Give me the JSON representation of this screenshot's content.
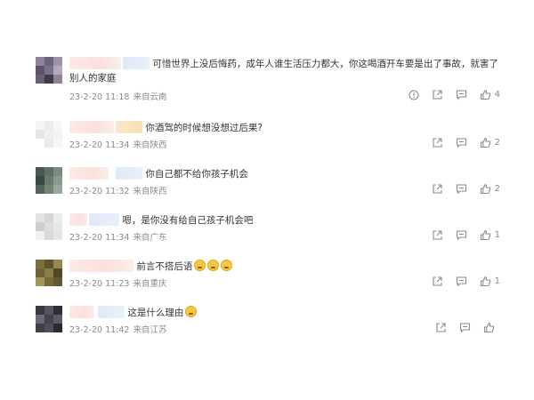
{
  "comments": [
    {
      "text": "可惜世界上没后悔药，成年人谁生活压力都大，你这喝酒开车要是出了事故，就害了别人的家庭",
      "time": "23-2-20 11:18",
      "location": "来自云南",
      "likes": "4",
      "has_report_icon": true,
      "avatar_colors": [
        "#8f8399",
        "#6d6479",
        "#9e93a8",
        "#5c5468",
        "#7c7187",
        "#b3a9bb",
        "#6a6075",
        "#3f394a",
        "#8e8398"
      ]
    },
    {
      "text": "你酒驾的时候想没想过后果?",
      "time": "23-2-20 11:34",
      "location": "来自陕西",
      "likes": "2",
      "avatar_colors": [
        "#f4f4f4",
        "#ececec",
        "#f7f7f7",
        "#e6e6e6",
        "#efefef",
        "#f2f2f2",
        "#ffffff",
        "#eaeaea",
        "#f6f6f6"
      ]
    },
    {
      "text": "你自己都不给你孩子机会",
      "time": "23-2-20 11:32",
      "location": "来自陕西",
      "likes": "2",
      "avatar_colors": [
        "#47594e",
        "#5f7062",
        "#7c8b7f",
        "#3b4a41",
        "#687a6c",
        "#8b9a8e",
        "#53645a",
        "#76857a",
        "#9aa89c"
      ]
    },
    {
      "text": "嗯，是你没有给自己孩子机会吧",
      "time": "23-2-20 11:34",
      "location": "来自广东",
      "likes": "1",
      "avatar_colors": [
        "#e3e3e3",
        "#d6d6d6",
        "#ececec",
        "#cfcfcf",
        "#dddddd",
        "#e8e8e8",
        "#f0f0f0",
        "#d9d9d9",
        "#e5e5e5"
      ]
    },
    {
      "text": "前言不搭后语",
      "time": "23-2-20 11:23",
      "location": "来自重庆",
      "likes": "1",
      "emoji_count": 3,
      "avatar_colors": [
        "#7a6e3d",
        "#5f5330",
        "#96894f",
        "#6e6236",
        "#8a7d45",
        "#534825",
        "#a39659",
        "#786b3a",
        "#645830"
      ]
    },
    {
      "text": "这是什么理由",
      "time": "23-2-20 11:42",
      "location": "来自江苏",
      "likes": "",
      "emoji_count": 1,
      "avatar_colors": [
        "#3a3a44",
        "#55555f",
        "#2e2e36",
        "#6a6a72",
        "#44444d",
        "#5c5c64",
        "#3f3f48",
        "#4f4f58",
        "#2a2a31"
      ]
    }
  ],
  "icons": {
    "report": "report-icon",
    "share": "share-icon",
    "comment": "comment-icon",
    "like": "like-icon"
  },
  "colors": {
    "text": "#333333",
    "meta": "#8a8a8a",
    "icon": "#8a8a8a"
  }
}
